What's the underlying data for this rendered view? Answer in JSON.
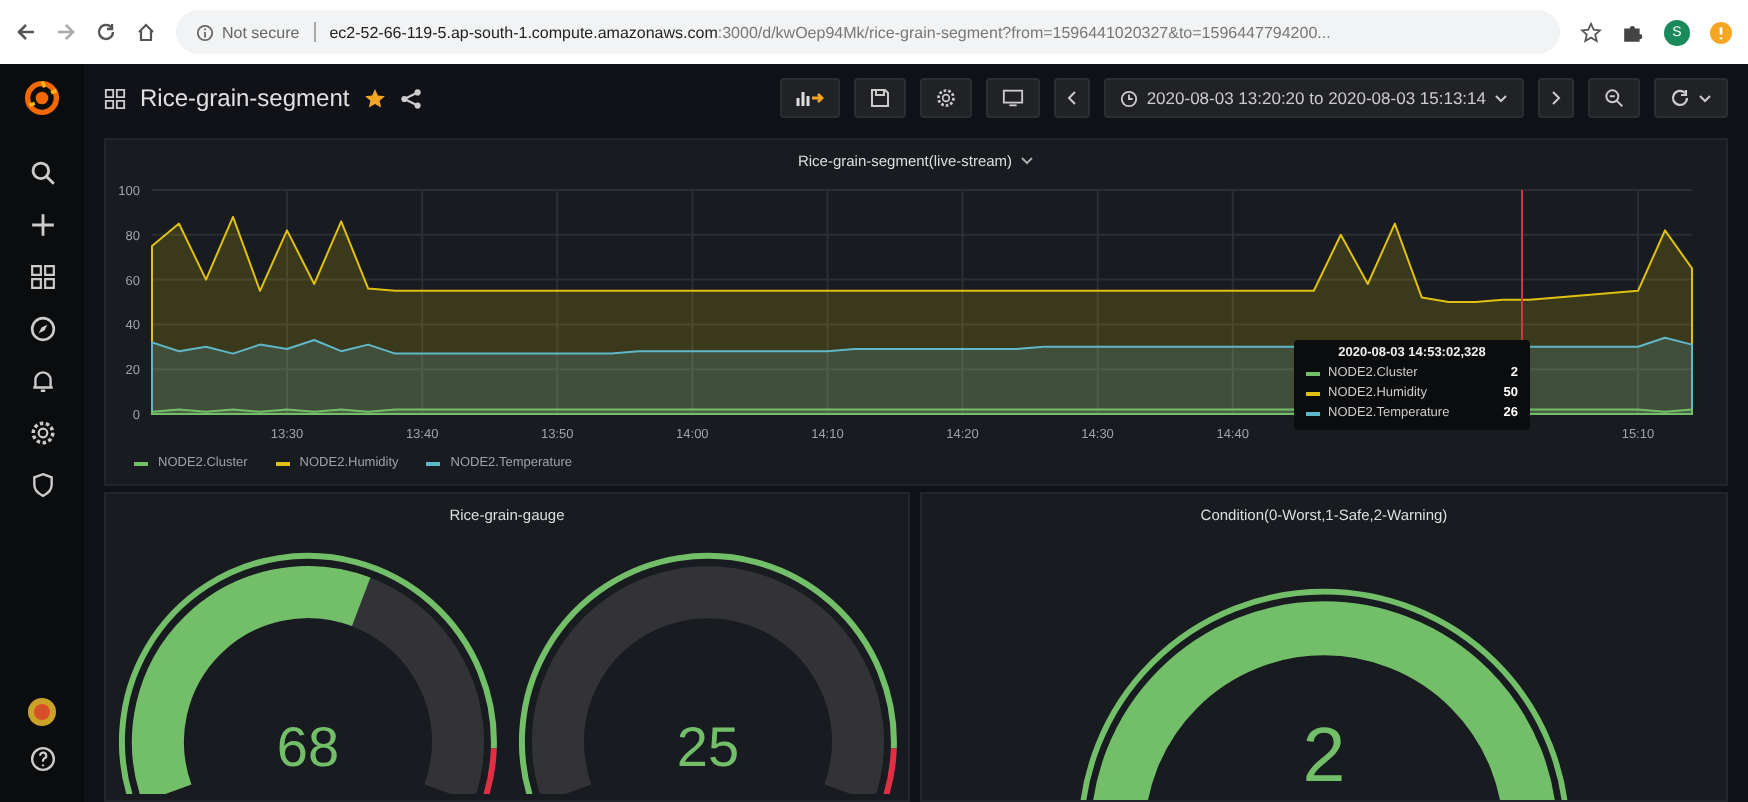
{
  "browser": {
    "security": "Not secure",
    "url_host": "ec2-52-66-119-5.ap-south-1.compute.amazonaws.com",
    "url_path": ":3000/d/kwOep94Mk/rice-grain-segment?from=1596441020327&to=1596447794200...",
    "profile_initial": "S"
  },
  "dashboard": {
    "title": "Rice-grain-segment",
    "starred": true,
    "time_range": "2020-08-03 13:20:20 to 2020-08-03 15:13:14"
  },
  "graph_panel": {
    "title": "Rice-grain-segment(live-stream)",
    "chart_data": {
      "type": "area",
      "categories": [
        null,
        null,
        null,
        null,
        null,
        "13:30",
        null,
        null,
        null,
        null,
        "13:40",
        null,
        null,
        null,
        null,
        "13:50",
        null,
        null,
        null,
        null,
        "14:00",
        null,
        null,
        null,
        null,
        "14:10",
        null,
        null,
        null,
        null,
        "14:20",
        null,
        null,
        null,
        null,
        "14:30",
        null,
        null,
        null,
        null,
        "14:40",
        null,
        null,
        null,
        null,
        null,
        null,
        null,
        null,
        null,
        null,
        null,
        null,
        null,
        null,
        "15:10",
        null,
        null
      ],
      "series": [
        {
          "name": "NODE2.Cluster",
          "color": "#73bf69",
          "values": [
            1,
            2,
            1,
            2,
            1,
            2,
            1,
            2,
            1,
            2,
            2,
            2,
            2,
            2,
            2,
            2,
            2,
            2,
            2,
            2,
            2,
            2,
            2,
            2,
            2,
            2,
            2,
            2,
            2,
            2,
            2,
            2,
            2,
            2,
            2,
            2,
            2,
            2,
            2,
            2,
            2,
            2,
            2,
            null,
            null,
            null,
            null,
            null,
            null,
            null,
            null,
            2,
            2,
            2,
            2,
            2,
            1,
            2
          ]
        },
        {
          "name": "NODE2.Humidity",
          "color": "#e0c010",
          "values": [
            75,
            85,
            60,
            88,
            55,
            82,
            58,
            86,
            56,
            55,
            55,
            55,
            55,
            55,
            55,
            55,
            55,
            55,
            55,
            55,
            55,
            55,
            55,
            55,
            55,
            55,
            55,
            55,
            55,
            55,
            55,
            55,
            55,
            55,
            55,
            55,
            55,
            55,
            55,
            55,
            55,
            55,
            55,
            55,
            80,
            58,
            85,
            52,
            50,
            50,
            51,
            51,
            52,
            53,
            54,
            55,
            82,
            65
          ]
        },
        {
          "name": "NODE2.Temperature",
          "color": "#5fb8c8",
          "values": [
            32,
            28,
            30,
            27,
            31,
            29,
            33,
            28,
            31,
            27,
            27,
            27,
            27,
            27,
            27,
            27,
            27,
            27,
            28,
            28,
            28,
            28,
            28,
            28,
            28,
            28,
            29,
            29,
            29,
            29,
            29,
            29,
            29,
            30,
            30,
            30,
            30,
            30,
            30,
            30,
            30,
            30,
            30,
            null,
            null,
            null,
            null,
            null,
            null,
            null,
            null,
            30,
            30,
            30,
            30,
            30,
            34,
            31
          ]
        }
      ],
      "grid": true,
      "legend": "bottom",
      "ylim": [
        0,
        100
      ],
      "yticks": [
        0,
        20,
        40,
        60,
        80,
        100
      ]
    },
    "tooltip": {
      "time": "2020-08-03 14:53:02,328",
      "rows": [
        {
          "name": "NODE2.Cluster",
          "value": "2",
          "color": "#73bf69"
        },
        {
          "name": "NODE2.Humidity",
          "value": "50",
          "color": "#e0c010"
        },
        {
          "name": "NODE2.Temperature",
          "value": "26",
          "color": "#5fb8c8"
        }
      ]
    }
  },
  "gauge_panel": {
    "title": "Rice-grain-gauge",
    "gauges": [
      {
        "value": "68"
      },
      {
        "value": "25"
      }
    ]
  },
  "stat_panel": {
    "title": "Condition(0-Worst,1-Safe,2-Warning)",
    "value": "2"
  }
}
